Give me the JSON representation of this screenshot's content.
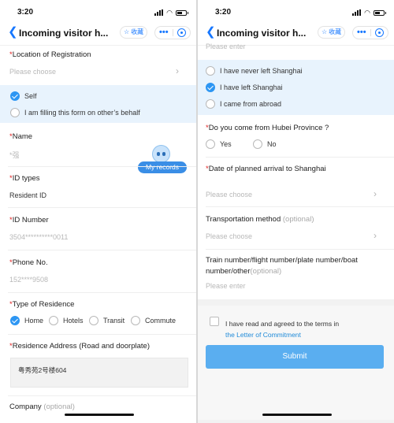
{
  "status_bar": {
    "time": "3:20"
  },
  "nav": {
    "title": "Incoming visitor h...",
    "fav_label": "收藏",
    "more_label": "•••"
  },
  "left": {
    "location": {
      "label": "Location of Registration",
      "placeholder": "Please choose"
    },
    "filler": {
      "options": [
        {
          "label": "Self",
          "selected": true
        },
        {
          "label": "I am filling this form on other’s behalf",
          "selected": false
        }
      ]
    },
    "name": {
      "label": "Name",
      "value": "*强"
    },
    "my_records": "My records",
    "id_type": {
      "label": "ID types",
      "value": "Resident ID"
    },
    "id_number": {
      "label": "ID Number",
      "value": "3504**********0011"
    },
    "phone": {
      "label": "Phone No.",
      "value": "152****9508"
    },
    "residence_type": {
      "label": "Type of Residence",
      "options": [
        {
          "label": "Home",
          "selected": true
        },
        {
          "label": "Hotels",
          "selected": false
        },
        {
          "label": "Transit",
          "selected": false
        },
        {
          "label": "Commute",
          "selected": false
        }
      ]
    },
    "residence_address": {
      "label": "Residence Address (Road and doorplate)",
      "value": "粤秀苑2号楼604"
    },
    "company": {
      "label": "Company",
      "optional": "(optional)"
    }
  },
  "right": {
    "top_placeholder": "Please enter",
    "travel_options": [
      {
        "label": "I have never left Shanghai",
        "selected": false
      },
      {
        "label": "I have left Shanghai",
        "selected": true
      },
      {
        "label": "I came from abroad",
        "selected": false
      }
    ],
    "hubei": {
      "label": "Do you come from Hubei Province ?",
      "options": [
        {
          "label": "Yes",
          "selected": false
        },
        {
          "label": "No",
          "selected": false
        }
      ]
    },
    "arrival_date": {
      "label": "Date of planned arrival to Shanghai",
      "placeholder": "Please choose"
    },
    "transport": {
      "label": "Transportation method",
      "optional": "(optional)",
      "placeholder": "Please choose"
    },
    "train_number": {
      "label_line1": "Train number/flight number/plate number/boat",
      "label_line2": "number/other",
      "optional": "(optional)",
      "placeholder": "Please enter"
    },
    "agreement": {
      "text": "I have read and agreed to the terms in",
      "link": "the Letter of Commitment"
    },
    "submit_label": "Submit"
  },
  "colors": {
    "accent": "#2d96f3",
    "required": "#e02020",
    "submit": "#5aaef0",
    "selected_band": "#e8f3fd"
  }
}
